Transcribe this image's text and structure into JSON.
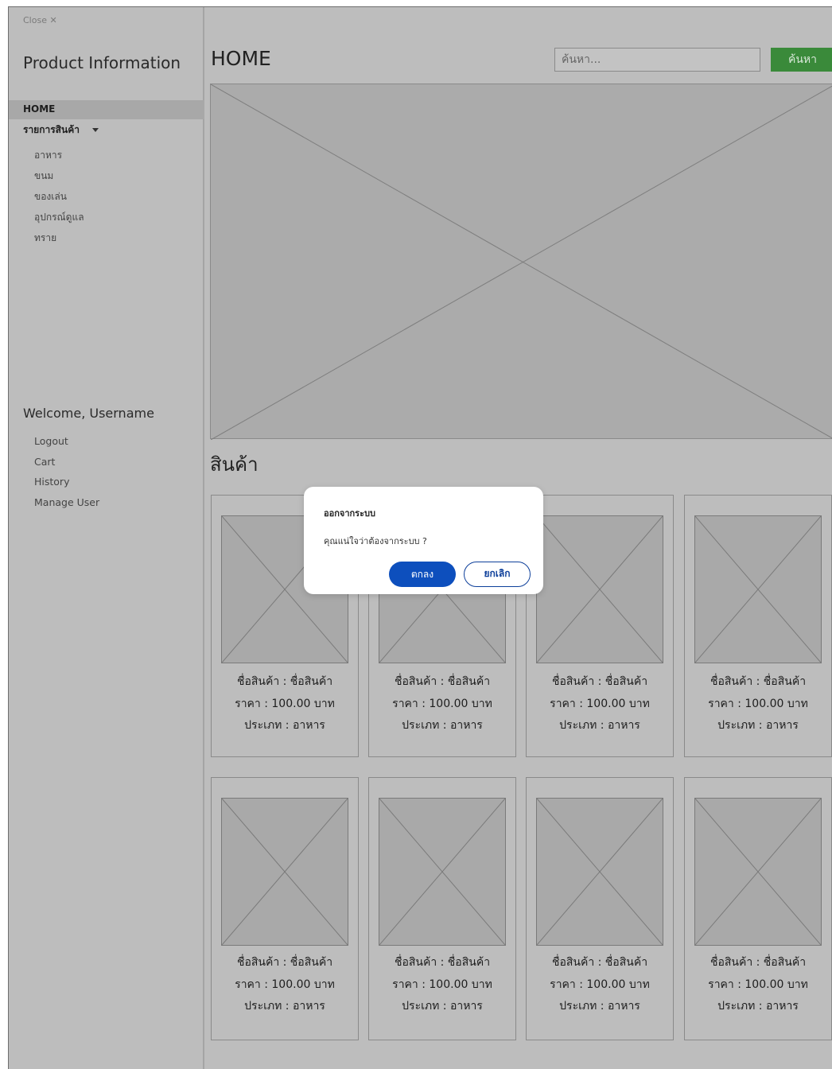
{
  "sidebar": {
    "close_label": "Close ✕",
    "title": "Product Information",
    "home_label": "HOME",
    "products_label": "รายการสินค้า",
    "product_categories": [
      "อาหาร",
      "ขนม",
      "ของเล่น",
      "อุปกรณ์ดูแล",
      "ทราย"
    ],
    "welcome": "Welcome, Username",
    "user_links": [
      "Logout",
      "Cart",
      "History",
      "Manage User"
    ]
  },
  "header": {
    "title": "HOME",
    "search_placeholder": "ค้นหา...",
    "search_button": "ค้นหา"
  },
  "products": {
    "section_title": "สินค้า",
    "items": [
      {
        "name": "ชื่อสินค้า : ชื่อสินค้า",
        "price": "ราคา :  100.00 บาท",
        "type": "ประเภท :  อาหาร"
      },
      {
        "name": "ชื่อสินค้า : ชื่อสินค้า",
        "price": "ราคา :  100.00 บาท",
        "type": "ประเภท :  อาหาร"
      },
      {
        "name": "ชื่อสินค้า : ชื่อสินค้า",
        "price": "ราคา :  100.00 บาท",
        "type": "ประเภท :  อาหาร"
      },
      {
        "name": "ชื่อสินค้า : ชื่อสินค้า",
        "price": "ราคา :  100.00 บาท",
        "type": "ประเภท :  อาหาร"
      },
      {
        "name": "ชื่อสินค้า : ชื่อสินค้า",
        "price": "ราคา :  100.00 บาท",
        "type": "ประเภท :  อาหาร"
      },
      {
        "name": "ชื่อสินค้า : ชื่อสินค้า",
        "price": "ราคา :  100.00 บาท",
        "type": "ประเภท :  อาหาร"
      },
      {
        "name": "ชื่อสินค้า : ชื่อสินค้า",
        "price": "ราคา :  100.00 บาท",
        "type": "ประเภท :  อาหาร"
      },
      {
        "name": "ชื่อสินค้า : ชื่อสินค้า",
        "price": "ราคา :  100.00 บาท",
        "type": "ประเภท :  อาหาร"
      }
    ]
  },
  "dialog": {
    "title": "ออกจากระบบ",
    "message": "คุณแน่ใจว่าต้องจากระบบ ?",
    "confirm_label": "ตกลง",
    "cancel_label": "ยกเลิก"
  },
  "colors": {
    "overlay_gray": "#bdbdbd",
    "search_button": "#3a8a3a",
    "confirm_button": "#0d4fbd"
  }
}
